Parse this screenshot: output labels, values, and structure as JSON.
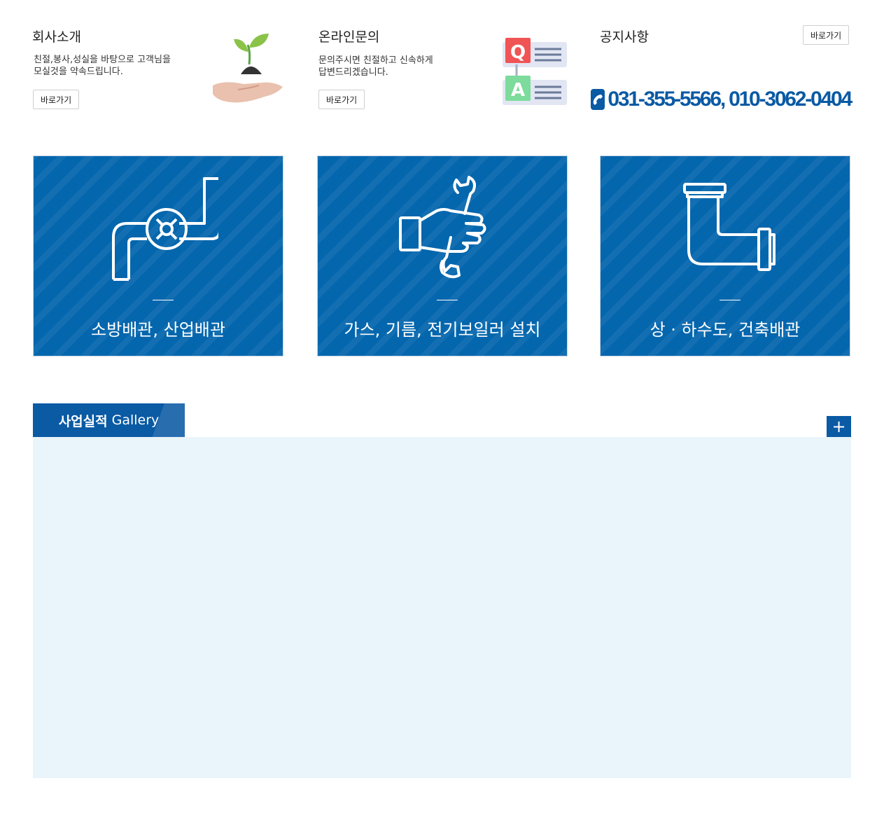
{
  "company": {
    "title": "회사소개",
    "description": "친절,봉사,성실을 바탕으로 고객님을\n모실것을 약속드립니다.",
    "button": "바로가기",
    "illustration_icon": "sprout-in-hand-icon"
  },
  "inquiry": {
    "title": "온라인문의",
    "description": "문의주시면 친절하고 신속하게\n답변드리겠습니다.",
    "button": "바로가기",
    "illustration_icon": "qa-icon",
    "q_letter": "Q",
    "a_letter": "A"
  },
  "notice": {
    "title": "공지사항",
    "button": "바로가기",
    "phone": "031-355-5566, 010-3062-0404",
    "phone_icon": "phone-icon"
  },
  "services": [
    {
      "label": "소방배관, 산업배관",
      "icon": "pipe-valve-icon"
    },
    {
      "label": "가스, 기름, 전기보일러 설치",
      "icon": "hand-wrench-icon"
    },
    {
      "label": "상 · 하수도, 건축배관",
      "icon": "elbow-pipe-icon"
    }
  ],
  "gallery": {
    "tab_strong": "사업실적",
    "tab_light": "Gallery",
    "more_symbol": "+"
  },
  "colors": {
    "brand_blue": "#0a5aa4",
    "card_blue": "#0466ad",
    "gallery_bg": "#eaf4fb",
    "q_red": "#f05454",
    "a_green": "#7ddb9c"
  }
}
